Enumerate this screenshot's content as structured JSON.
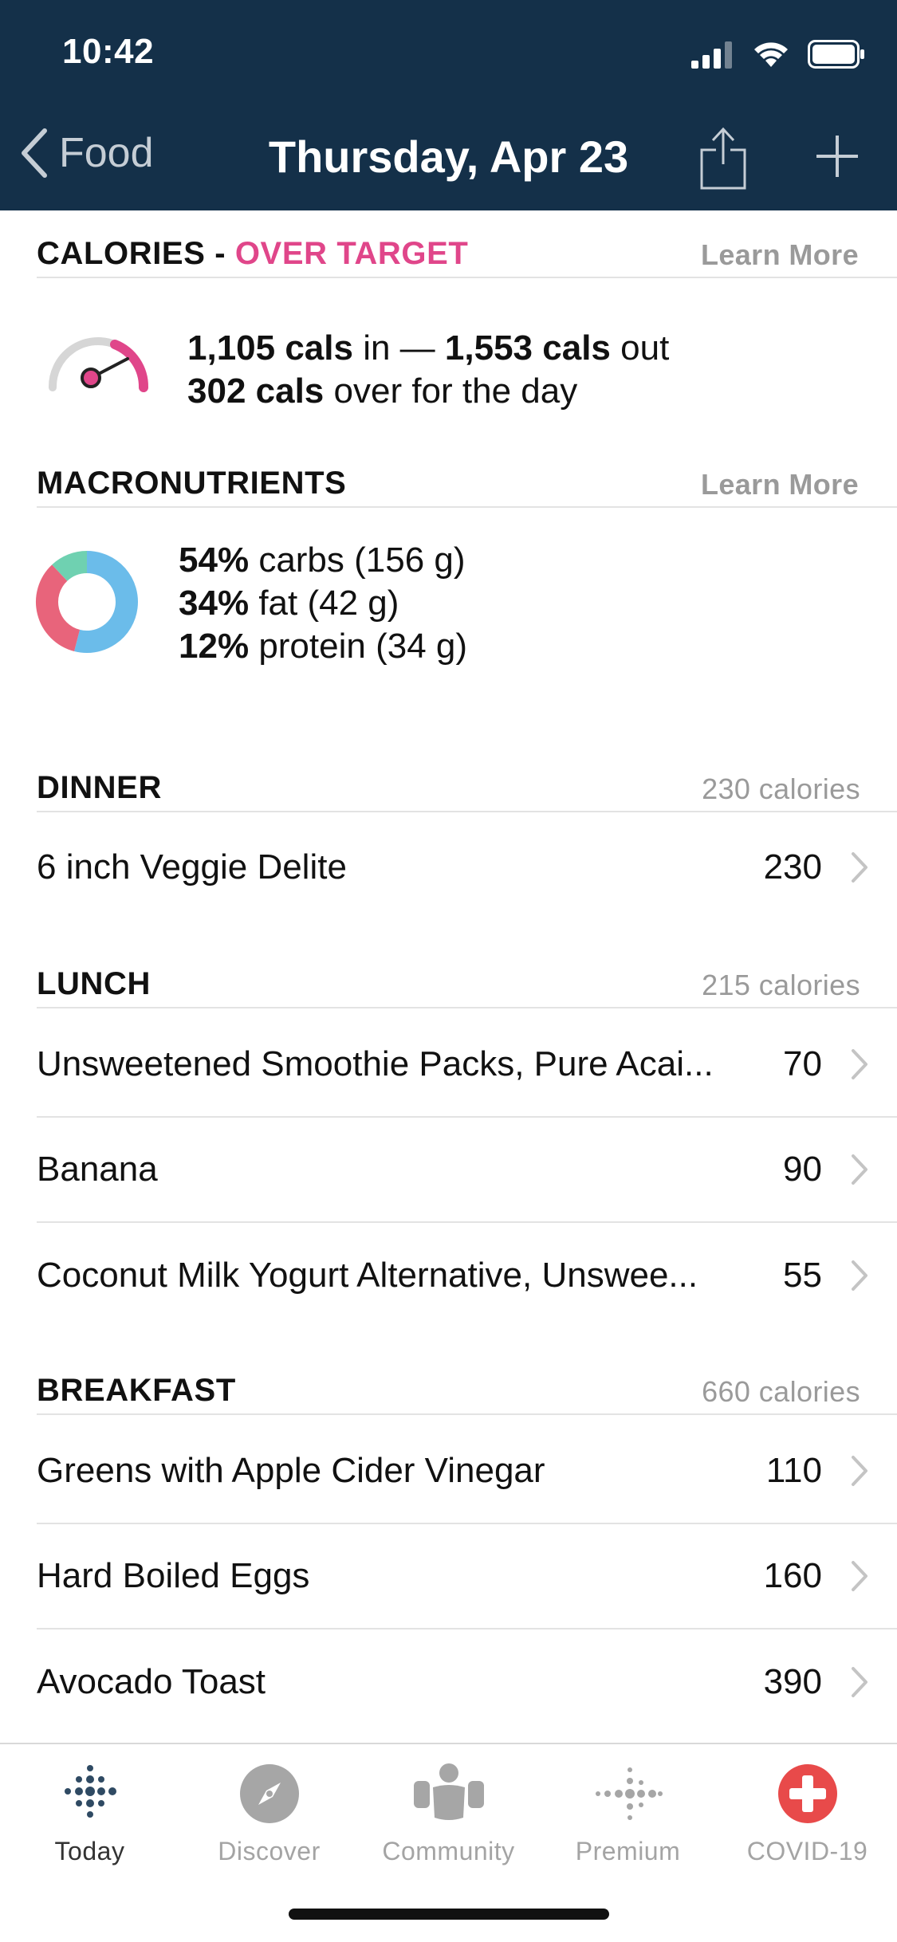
{
  "status": {
    "time": "10:42"
  },
  "nav": {
    "back_label": "Food",
    "title": "Thursday, Apr 23"
  },
  "calories": {
    "heading": "CALORIES",
    "separator": "-",
    "status": "OVER TARGET",
    "learn_more": "Learn More",
    "in_value": "1,105 cals",
    "in_suffix": "in —",
    "out_value": "1,553 cals",
    "out_suffix": "out",
    "over_value": "302 cals",
    "over_suffix": "over for the day"
  },
  "macros": {
    "heading": "MACRONUTRIENTS",
    "learn_more": "Learn More",
    "items": [
      {
        "pct": "54%",
        "label": "carbs (156 g)",
        "fraction": 0.54,
        "color": "#6bbcea"
      },
      {
        "pct": "34%",
        "label": "fat (42 g)",
        "fraction": 0.34,
        "color": "#e8647b"
      },
      {
        "pct": "12%",
        "label": "protein (34 g)",
        "fraction": 0.12,
        "color": "#6fd1b1"
      }
    ]
  },
  "meals": [
    {
      "title": "DINNER",
      "calories": "230 calories",
      "items": [
        {
          "name": "6 inch Veggie Delite",
          "value": "230"
        }
      ]
    },
    {
      "title": "LUNCH",
      "calories": "215 calories",
      "items": [
        {
          "name": "Unsweetened Smoothie Packs, Pure Acai...",
          "value": "70"
        },
        {
          "name": "Banana",
          "value": "90"
        },
        {
          "name": "Coconut Milk Yogurt Alternative, Unswee...",
          "value": "55"
        }
      ]
    },
    {
      "title": "BREAKFAST",
      "calories": "660 calories",
      "items": [
        {
          "name": "Greens with Apple Cider Vinegar",
          "value": "110"
        },
        {
          "name": "Hard Boiled Eggs",
          "value": "160"
        },
        {
          "name": "Avocado Toast",
          "value": "390"
        }
      ]
    }
  ],
  "tabs": [
    {
      "label": "Today",
      "icon": "fitbit-dots-icon"
    },
    {
      "label": "Discover",
      "icon": "compass-icon"
    },
    {
      "label": "Community",
      "icon": "community-icon"
    },
    {
      "label": "Premium",
      "icon": "premium-dots-icon"
    },
    {
      "label": "COVID-19",
      "icon": "medical-cross-icon"
    }
  ],
  "colors": {
    "header_bg": "#143049",
    "over_target": "#e0468a",
    "covid_red": "#e84a4a"
  }
}
